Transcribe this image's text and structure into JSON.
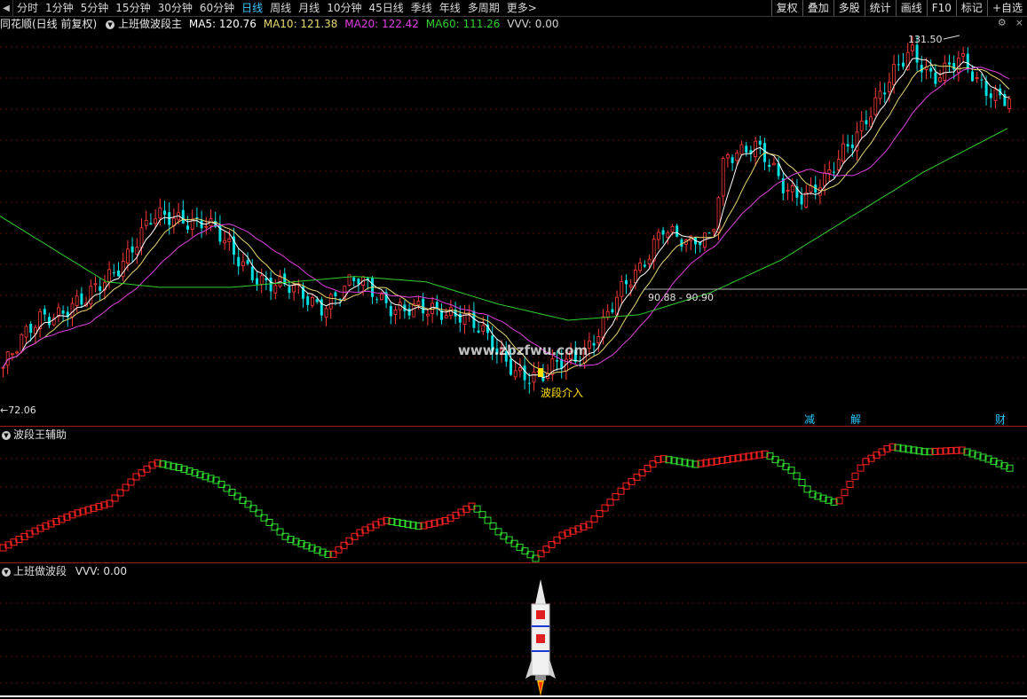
{
  "toolbar": {
    "periods": [
      "分时",
      "1分钟",
      "5分钟",
      "15分钟",
      "30分钟",
      "60分钟",
      "日线",
      "周线",
      "月线",
      "10分钟",
      "45日线",
      "季线",
      "年线",
      "多周期",
      "更多>"
    ],
    "active_index": 6,
    "right_buttons": [
      "复权",
      "叠加",
      "多股",
      "统计",
      "画线",
      "F10",
      "标记",
      "+自选"
    ]
  },
  "info_bar": {
    "stock_label": "同花顺(日线 前复权)",
    "indicator": "上班做波段主",
    "ma5_label": "MA5: 120.76",
    "ma10_label": "MA10: 121.38",
    "ma20_label": "MA20: 122.42",
    "ma60_label": "MA60: 111.26",
    "vvv_label": "VVV: 0.00"
  },
  "main_chart": {
    "price_range": [
      68,
      136
    ],
    "high_label": "131.50",
    "low_label": "←72.06",
    "range_label": "90.88 - 90.90",
    "signal_label": "波段介入",
    "watermark": "www.zbzfwu.com",
    "event_markers": [
      "减",
      "解",
      "财"
    ],
    "colors": {
      "up": "#ff3a3a",
      "down": "#00e0e0",
      "ma5": "#ffffff",
      "ma10": "#e8d870",
      "ma20": "#e040e0",
      "ma60": "#30d030"
    }
  },
  "panel2": {
    "title": "波段王辅助"
  },
  "panel3": {
    "title": "上班做波段",
    "vvv_label": "VVV: 0.00"
  }
}
